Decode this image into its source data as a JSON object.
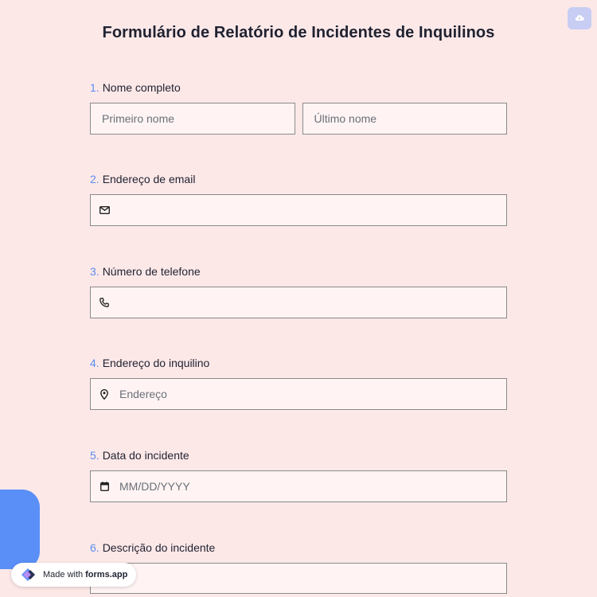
{
  "form": {
    "title": "Formulário de Relatório de Incidentes de Inquilinos",
    "questions": [
      {
        "num": "1.",
        "label": "Nome completo",
        "first_placeholder": "Primeiro nome",
        "last_placeholder": "Último nome"
      },
      {
        "num": "2.",
        "label": "Endereço de email",
        "placeholder": "",
        "icon": "mail-icon"
      },
      {
        "num": "3.",
        "label": "Número de telefone",
        "placeholder": "",
        "icon": "phone-icon"
      },
      {
        "num": "4.",
        "label": "Endereço do inquilino",
        "placeholder": "Endereço",
        "icon": "map-pin-icon"
      },
      {
        "num": "5.",
        "label": "Data do incidente",
        "placeholder": "MM/DD/YYYY",
        "icon": "calendar-icon"
      },
      {
        "num": "6.",
        "label": "Descrição do incidente",
        "placeholder": ""
      }
    ]
  },
  "toolbar": {
    "icon": "cloud-upload-icon"
  },
  "badge": {
    "prefix": "Made with",
    "brand": "forms.app",
    "icon": "forms-app-logo-icon"
  },
  "colors": {
    "background": "#fde8e8",
    "field_background": "#fff4f3",
    "accent": "#5b8def",
    "upload_button": "#c7cdf3",
    "blob": "#5a8ff7"
  }
}
